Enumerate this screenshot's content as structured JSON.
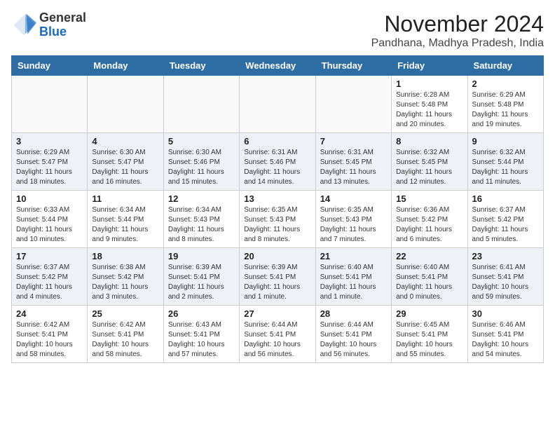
{
  "header": {
    "logo_general": "General",
    "logo_blue": "Blue",
    "month_title": "November 2024",
    "location": "Pandhana, Madhya Pradesh, India"
  },
  "weekdays": [
    "Sunday",
    "Monday",
    "Tuesday",
    "Wednesday",
    "Thursday",
    "Friday",
    "Saturday"
  ],
  "weeks": [
    [
      {
        "day": "",
        "info": ""
      },
      {
        "day": "",
        "info": ""
      },
      {
        "day": "",
        "info": ""
      },
      {
        "day": "",
        "info": ""
      },
      {
        "day": "",
        "info": ""
      },
      {
        "day": "1",
        "info": "Sunrise: 6:28 AM\nSunset: 5:48 PM\nDaylight: 11 hours and 20 minutes."
      },
      {
        "day": "2",
        "info": "Sunrise: 6:29 AM\nSunset: 5:48 PM\nDaylight: 11 hours and 19 minutes."
      }
    ],
    [
      {
        "day": "3",
        "info": "Sunrise: 6:29 AM\nSunset: 5:47 PM\nDaylight: 11 hours and 18 minutes."
      },
      {
        "day": "4",
        "info": "Sunrise: 6:30 AM\nSunset: 5:47 PM\nDaylight: 11 hours and 16 minutes."
      },
      {
        "day": "5",
        "info": "Sunrise: 6:30 AM\nSunset: 5:46 PM\nDaylight: 11 hours and 15 minutes."
      },
      {
        "day": "6",
        "info": "Sunrise: 6:31 AM\nSunset: 5:46 PM\nDaylight: 11 hours and 14 minutes."
      },
      {
        "day": "7",
        "info": "Sunrise: 6:31 AM\nSunset: 5:45 PM\nDaylight: 11 hours and 13 minutes."
      },
      {
        "day": "8",
        "info": "Sunrise: 6:32 AM\nSunset: 5:45 PM\nDaylight: 11 hours and 12 minutes."
      },
      {
        "day": "9",
        "info": "Sunrise: 6:32 AM\nSunset: 5:44 PM\nDaylight: 11 hours and 11 minutes."
      }
    ],
    [
      {
        "day": "10",
        "info": "Sunrise: 6:33 AM\nSunset: 5:44 PM\nDaylight: 11 hours and 10 minutes."
      },
      {
        "day": "11",
        "info": "Sunrise: 6:34 AM\nSunset: 5:44 PM\nDaylight: 11 hours and 9 minutes."
      },
      {
        "day": "12",
        "info": "Sunrise: 6:34 AM\nSunset: 5:43 PM\nDaylight: 11 hours and 8 minutes."
      },
      {
        "day": "13",
        "info": "Sunrise: 6:35 AM\nSunset: 5:43 PM\nDaylight: 11 hours and 8 minutes."
      },
      {
        "day": "14",
        "info": "Sunrise: 6:35 AM\nSunset: 5:43 PM\nDaylight: 11 hours and 7 minutes."
      },
      {
        "day": "15",
        "info": "Sunrise: 6:36 AM\nSunset: 5:42 PM\nDaylight: 11 hours and 6 minutes."
      },
      {
        "day": "16",
        "info": "Sunrise: 6:37 AM\nSunset: 5:42 PM\nDaylight: 11 hours and 5 minutes."
      }
    ],
    [
      {
        "day": "17",
        "info": "Sunrise: 6:37 AM\nSunset: 5:42 PM\nDaylight: 11 hours and 4 minutes."
      },
      {
        "day": "18",
        "info": "Sunrise: 6:38 AM\nSunset: 5:42 PM\nDaylight: 11 hours and 3 minutes."
      },
      {
        "day": "19",
        "info": "Sunrise: 6:39 AM\nSunset: 5:41 PM\nDaylight: 11 hours and 2 minutes."
      },
      {
        "day": "20",
        "info": "Sunrise: 6:39 AM\nSunset: 5:41 PM\nDaylight: 11 hours and 1 minute."
      },
      {
        "day": "21",
        "info": "Sunrise: 6:40 AM\nSunset: 5:41 PM\nDaylight: 11 hours and 1 minute."
      },
      {
        "day": "22",
        "info": "Sunrise: 6:40 AM\nSunset: 5:41 PM\nDaylight: 11 hours and 0 minutes."
      },
      {
        "day": "23",
        "info": "Sunrise: 6:41 AM\nSunset: 5:41 PM\nDaylight: 10 hours and 59 minutes."
      }
    ],
    [
      {
        "day": "24",
        "info": "Sunrise: 6:42 AM\nSunset: 5:41 PM\nDaylight: 10 hours and 58 minutes."
      },
      {
        "day": "25",
        "info": "Sunrise: 6:42 AM\nSunset: 5:41 PM\nDaylight: 10 hours and 58 minutes."
      },
      {
        "day": "26",
        "info": "Sunrise: 6:43 AM\nSunset: 5:41 PM\nDaylight: 10 hours and 57 minutes."
      },
      {
        "day": "27",
        "info": "Sunrise: 6:44 AM\nSunset: 5:41 PM\nDaylight: 10 hours and 56 minutes."
      },
      {
        "day": "28",
        "info": "Sunrise: 6:44 AM\nSunset: 5:41 PM\nDaylight: 10 hours and 56 minutes."
      },
      {
        "day": "29",
        "info": "Sunrise: 6:45 AM\nSunset: 5:41 PM\nDaylight: 10 hours and 55 minutes."
      },
      {
        "day": "30",
        "info": "Sunrise: 6:46 AM\nSunset: 5:41 PM\nDaylight: 10 hours and 54 minutes."
      }
    ]
  ]
}
